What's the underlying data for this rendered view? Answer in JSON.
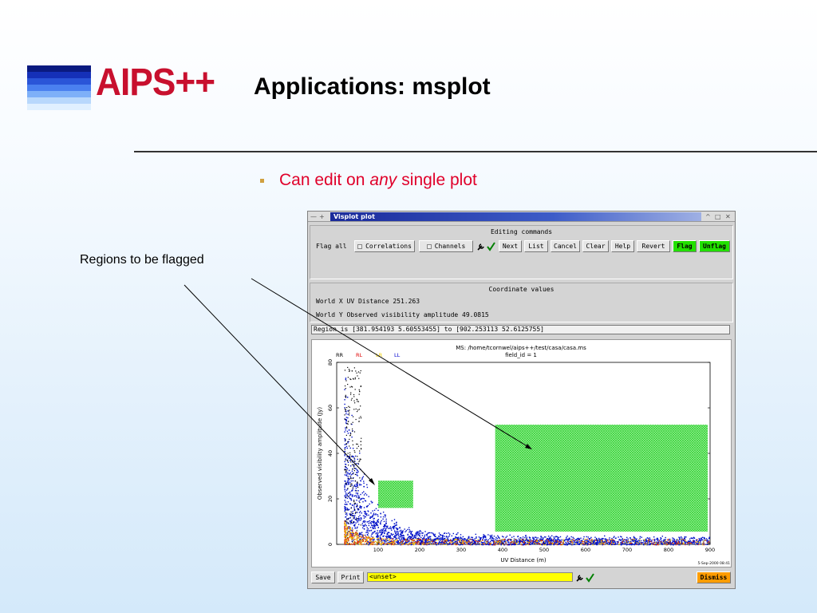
{
  "slide": {
    "logo_text": "AIPS++",
    "title": "Applications: msplot",
    "bullet_pre": "Can edit on",
    "bullet_em": "any",
    "bullet_post": "single plot",
    "callout": "Regions to be flagged"
  },
  "window": {
    "title": "Visplot plot",
    "title_controls": [
      "^",
      "□",
      "✕"
    ],
    "editing": {
      "heading": "Editing commands",
      "flag_all_label": "Flag all",
      "buttons": [
        "Correlations",
        "Channels",
        "Next",
        "List",
        "Cancel",
        "Clear",
        "Help",
        "Revert",
        "Flag",
        "Unflag"
      ]
    },
    "coords": {
      "heading": "Coordinate values",
      "world_x": "World X  UV Distance 251.263",
      "world_y": "World Y  Observed visibility amplitude 49.0815"
    },
    "region": "Region is [381.954193 5.60553455]  to [902.253113 52.6125755]",
    "bottom": {
      "save": "Save",
      "print": "Print",
      "input_value": "<unset>",
      "dismiss": "Dismiss"
    }
  },
  "chart_data": {
    "type": "scatter",
    "title": "MS: /home/tcornwel/aips++/test/casa/casa.ms",
    "subtitle": "field_id = 1",
    "xlabel": "UV Distance (m)",
    "ylabel": "Observed visibility amplitude (Jy)",
    "xlim": [
      0,
      900
    ],
    "ylim": [
      0,
      80
    ],
    "xticks": [
      100,
      200,
      300,
      400,
      500,
      600,
      700,
      800,
      900
    ],
    "yticks": [
      0,
      20,
      40,
      60,
      80
    ],
    "timestamp": "5-Sep-2000 08:41",
    "legend": [
      {
        "name": "RR",
        "color": "#000000"
      },
      {
        "name": "RL",
        "color": "#e00000"
      },
      {
        "name": "LR",
        "color": "#f0d000"
      },
      {
        "name": "LL",
        "color": "#0000d0"
      }
    ],
    "flag_regions": [
      {
        "x": [
          381.95,
          902.25
        ],
        "y": [
          5.61,
          52.61
        ]
      },
      {
        "x": [
          100,
          190
        ],
        "y": [
          16,
          28
        ]
      }
    ],
    "series_note": "dense scatter: LL (blue) decaying from ~80 Jy near 20 m to ~5 Jy beyond 300 m; RR/RL near 0-10 Jy"
  }
}
